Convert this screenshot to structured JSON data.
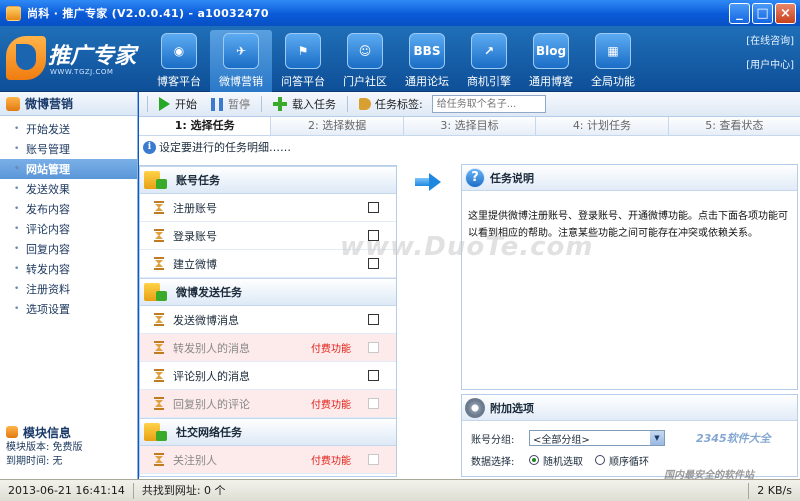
{
  "window": {
    "title": "尚科 · 推广专家 (V2.0.0.41) - a10032470",
    "buttons": [
      "_",
      "□",
      "×"
    ]
  },
  "logo": {
    "name": "推广专家",
    "url": "WWW.TGZJ.COM"
  },
  "nav": [
    {
      "label": "博客平台",
      "icon": "rss-icon",
      "glyph": "◉"
    },
    {
      "label": "微博营销",
      "icon": "bird-icon",
      "glyph": "✈"
    },
    {
      "label": "问答平台",
      "icon": "flag-icon",
      "glyph": "⚑"
    },
    {
      "label": "门户社区",
      "icon": "users-icon",
      "glyph": "☺"
    },
    {
      "label": "通用论坛",
      "icon": "bbs-icon",
      "glyph": "BBS"
    },
    {
      "label": "商机引擎",
      "icon": "chart-icon",
      "glyph": "↗"
    },
    {
      "label": "通用博客",
      "icon": "blog-icon",
      "glyph": "Blog"
    },
    {
      "label": "全局功能",
      "icon": "grid-icon",
      "glyph": "▦"
    }
  ],
  "toplinks": {
    "online": "[在线咨询]",
    "user": "[用户中心]"
  },
  "sidebar": {
    "title": "微博营销",
    "items": [
      "开始发送",
      "账号管理",
      "网站管理",
      "发送效果",
      "发布内容",
      "评论内容",
      "回复内容",
      "转发内容",
      "注册资料",
      "选项设置"
    ],
    "module": {
      "title": "模块信息",
      "version": "模块版本: 免费版",
      "expire": "到期时间: 无"
    }
  },
  "toolbar": {
    "start": "开始",
    "pause": "暂停",
    "load": "载入任务",
    "tag_label": "任务标签:",
    "tag_placeholder": "给任务取个名子..."
  },
  "steps": [
    "1: 选择任务",
    "2: 选择数据",
    "3: 选择目标",
    "4: 计划任务",
    "5: 查看状态"
  ],
  "hint": "设定要进行的任务明细……",
  "tasks": {
    "groups": [
      {
        "title": "账号任务",
        "items": [
          {
            "label": "注册账号",
            "paid": ""
          },
          {
            "label": "登录账号",
            "paid": ""
          },
          {
            "label": "建立微博",
            "paid": ""
          }
        ]
      },
      {
        "title": "微博发送任务",
        "items": [
          {
            "label": "发送微博消息",
            "paid": ""
          },
          {
            "label": "转发别人的消息",
            "paid": "付费功能"
          },
          {
            "label": "评论别人的消息",
            "paid": ""
          },
          {
            "label": "回复别人的评论",
            "paid": "付费功能"
          }
        ]
      },
      {
        "title": "社交网络任务",
        "items": [
          {
            "label": "关注别人",
            "paid": "付费功能"
          }
        ]
      }
    ]
  },
  "description": {
    "title": "任务说明",
    "text": "这里提供微博注册账号、登录账号、开通微博功能。点击下面各项功能可以看到相应的帮助。注意某些功能之间可能存在冲突或依赖关系。"
  },
  "extra": {
    "title": "附加选项",
    "group_label": "账号分组:",
    "group_value": "<全部分组>",
    "data_label": "数据选择:",
    "options": [
      {
        "label": "随机选取",
        "checked": true
      },
      {
        "label": "顺序循环",
        "checked": false
      }
    ]
  },
  "status": {
    "datetime": "2013-06-21 16:41:14",
    "found": "共找到网址: 0 个",
    "speed": "2 KB/s"
  },
  "watermarks": {
    "main": "www.DuoTe.com",
    "brand": "2345软件大全",
    "slogan": "国内最安全的软件站"
  }
}
